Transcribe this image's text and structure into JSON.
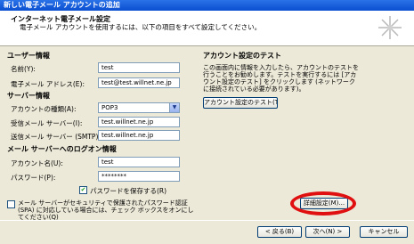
{
  "window": {
    "title": "新しい電子メール アカウントの追加"
  },
  "header": {
    "title": "インターネット電子メール設定",
    "description": "電子メール アカウントを使用するには、以下の項目をすべて設定してください。"
  },
  "user_info": {
    "section": "ユーザー情報",
    "name_label": "名前(Y):",
    "name_value": "test",
    "email_label": "電子メール アドレス(E):",
    "email_value": "test@test.willnet.ne.jp"
  },
  "server_info": {
    "section": "サーバー情報",
    "account_type_label": "アカウントの種類(A):",
    "account_type_value": "POP3",
    "incoming_label": "受信メール サーバー(I):",
    "incoming_value": "test.willnet.ne.jp",
    "outgoing_label": "送信メール サーバー (SMTP)(O):",
    "outgoing_value": "test.willnet.ne.jp"
  },
  "logon_info": {
    "section": "メール サーバーへのログオン情報",
    "account_name_label": "アカウント名(U):",
    "account_name_value": "test",
    "password_label": "パスワード(P):",
    "password_value": "********",
    "remember_label": "パスワードを保存する(R)",
    "remember_checked": true,
    "spa_label": "メール サーバーがセキュリティで保護されたパスワード認証 (SPA) に対応している場合には、チェック ボックスをオンにしてください(Q)",
    "spa_checked": false
  },
  "test_settings": {
    "section": "アカウント設定のテスト",
    "description": "この画面内に情報を入力したら、アカウントのテストを行うことをお勧めします。テストを実行するには [アカウント設定のテスト] をクリックします (ネットワークに接続されている必要があります)。",
    "test_button": "アカウント設定のテスト(T)..."
  },
  "buttons": {
    "more_settings": "詳細設定(M)...",
    "back": "< 戻る(B)",
    "next": "次へ(N) >",
    "cancel": "キャンセル"
  },
  "colors": {
    "highlight": "#e01010",
    "titlebar": "#0a4fd0"
  },
  "icons": {
    "header": "sparkle-star-icon",
    "combo": "chevron-down-icon",
    "checkmark": "checkmark-icon"
  }
}
